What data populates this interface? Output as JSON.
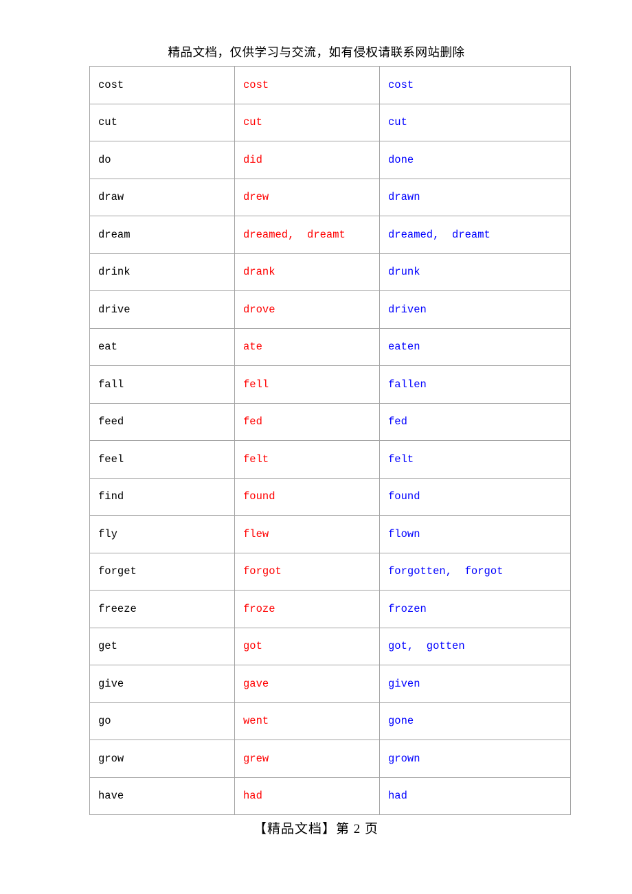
{
  "header": {
    "notice": "精品文档，仅供学习与交流，如有侵权请联系网站删除"
  },
  "footer": {
    "text": "【精品文档】第 2 页"
  },
  "colors": {
    "base_form": "#000000",
    "past_simple": "#FF0000",
    "past_participle": "#0000FF",
    "border": "#a3a3a3",
    "page_background": "#ffffff"
  },
  "table": {
    "rows": [
      {
        "base": "cost",
        "past": "cost",
        "participle": "cost"
      },
      {
        "base": "cut",
        "past": "cut",
        "participle": "cut"
      },
      {
        "base": "do",
        "past": "did",
        "participle": "done"
      },
      {
        "base": "draw",
        "past": "drew",
        "participle": "drawn"
      },
      {
        "base": "dream",
        "past": "dreamed,  dreamt",
        "participle": "dreamed,  dreamt"
      },
      {
        "base": "drink",
        "past": "drank",
        "participle": "drunk"
      },
      {
        "base": "drive",
        "past": "drove",
        "participle": "driven"
      },
      {
        "base": "eat",
        "past": "ate",
        "participle": "eaten"
      },
      {
        "base": "fall",
        "past": "fell",
        "participle": "fallen"
      },
      {
        "base": "feed",
        "past": "fed",
        "participle": "fed"
      },
      {
        "base": "feel",
        "past": "felt",
        "participle": "felt"
      },
      {
        "base": "find",
        "past": "found",
        "participle": "found"
      },
      {
        "base": "fly",
        "past": "flew",
        "participle": "flown"
      },
      {
        "base": "forget",
        "past": "forgot",
        "participle": "forgotten,  forgot"
      },
      {
        "base": "freeze",
        "past": "froze",
        "participle": "frozen"
      },
      {
        "base": "get",
        "past": "got",
        "participle": "got,  gotten"
      },
      {
        "base": "give",
        "past": "gave",
        "participle": "given"
      },
      {
        "base": "go",
        "past": "went",
        "participle": "gone"
      },
      {
        "base": "grow",
        "past": "grew",
        "participle": "grown"
      },
      {
        "base": "have",
        "past": "had",
        "participle": "had"
      }
    ]
  }
}
